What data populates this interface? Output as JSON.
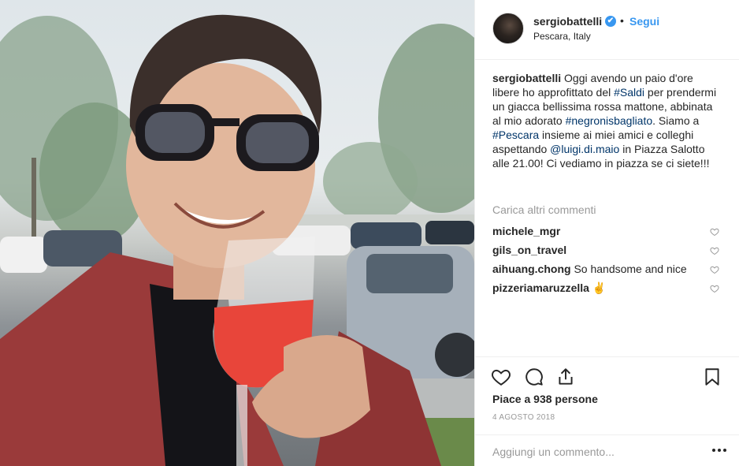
{
  "post": {
    "username": "sergiobattelli",
    "verified_mark": "✔",
    "separator": "•",
    "follow_label": "Segui",
    "location": "Pescara, Italy"
  },
  "caption": {
    "username": "sergiobattelli",
    "text_1": " Oggi avendo un paio d'ore libere ho approfittato del ",
    "tag_1": "#Saldi",
    "text_2": " per prendermi un giacca bellissima rossa mattone, abbinata al mio adorato ",
    "tag_2": "#negronisbagliato",
    "text_3": ". Siamo a ",
    "tag_3": "#Pescara",
    "text_4": " insieme ai miei amici e colleghi aspettando ",
    "mention": "@luigi.di.maio",
    "text_5": " in Piazza Salotto alle 21.00! Ci vediamo in piazza se ci siete!!!"
  },
  "load_more_label": "Carica altri commenti",
  "comments": [
    {
      "user": "michele_mgr",
      "text": ""
    },
    {
      "user": "gils_on_travel",
      "text": ""
    },
    {
      "user": "aihuang.chong",
      "text": " So handsome and nice"
    },
    {
      "user": "pizzeriamaruzzella",
      "text": " ✌"
    }
  ],
  "icons": {
    "like": "heart-icon",
    "comment": "comment-bubble-icon",
    "share": "share-icon",
    "save": "bookmark-icon",
    "comment_like": "small-heart-icon",
    "more": "more-options-icon"
  },
  "likes_label": "Piace a 938 persone",
  "date_label": "4 AGOSTO 2018",
  "comment_placeholder": "Aggiungi un commento...",
  "colors": {
    "link_blue": "#3897f0",
    "hashtag": "#003569",
    "muted": "#999999",
    "text": "#262626",
    "jacket": "#9a3a3a",
    "drink": "#e8453a"
  }
}
